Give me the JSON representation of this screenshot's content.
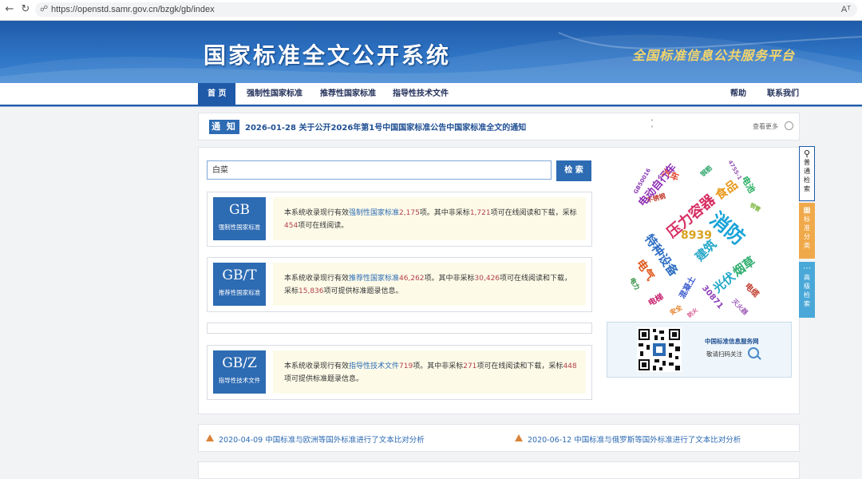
{
  "browser": {
    "back_icon": "arrow-left-icon",
    "reload_icon": "reload-icon",
    "url": "https://openstd.samr.gov.cn/bzgk/gb/index",
    "reader_label": "Aᵀ"
  },
  "banner": {
    "title": "国家标准全文公开系统",
    "slogan": "全国标准信息公共服务平台"
  },
  "nav": {
    "items": [
      "首 页",
      "强制性国家标准",
      "推荐性国家标准",
      "指导性技术文件"
    ],
    "right_items": [
      "帮助",
      "联系我们"
    ]
  },
  "notice": {
    "badge": "通 知",
    "text": "2026-01-28  关于公开2026年第1号中国国家标准公告中国家标准全文的通知",
    "more": "查看更多"
  },
  "search": {
    "value": "白菜",
    "button": "检 索"
  },
  "categories": [
    {
      "code": "GB",
      "subtitle": "强制性国家标准",
      "desc_parts": {
        "a": "本系统收录现行有效",
        "type": "强制性国家标准",
        "count": "2,175",
        "b": "项。其中非采标",
        "nonadopt": "1,721",
        "c": "项可在线阅读和下载，采标",
        "adopt": "454",
        "d": "项可在线阅读。"
      }
    },
    {
      "code": "GB/T",
      "subtitle": "推荐性国家标准",
      "desc_parts": {
        "a": "本系统收录现行有效",
        "type": "推荐性国家标准",
        "count": "46,262",
        "b": "项。其中非采标",
        "nonadopt": "30,426",
        "c": "项可在线阅读和下载，采标",
        "adopt": "15,836",
        "d": "项可提供标准题录信息。"
      }
    },
    {
      "code": "GB/Z",
      "subtitle": "指导性技术文件",
      "desc_parts": {
        "a": "本系统收录现行有效",
        "type": "指导性技术文件",
        "count": "719",
        "b": "项。其中非采标",
        "nonadopt": "271",
        "c": "项可在线阅读和下载，采标",
        "adopt": "448",
        "d": "项可提供标准题录信息。"
      }
    }
  ],
  "word_cloud": [
    {
      "text": "GB50016",
      "color": "#8b3fb5"
    },
    {
      "text": "汽车",
      "color": "#e0462f"
    },
    {
      "text": "钢筋",
      "color": "#2fa56b"
    },
    {
      "text": "4755-1",
      "color": "#9b59b6"
    },
    {
      "text": "不锈钢",
      "color": "#c0392b"
    },
    {
      "text": "电动自行车",
      "color": "#8e2fb5"
    },
    {
      "text": "食品",
      "color": "#e89a1d"
    },
    {
      "text": "电池",
      "color": "#27ae60"
    },
    {
      "text": "压力容器",
      "color": "#d62d62"
    },
    {
      "text": "钢管",
      "color": "#7ab63a"
    },
    {
      "text": "消防",
      "color": "#1aa3d8"
    },
    {
      "text": "8939",
      "color": "#d9a21f"
    },
    {
      "text": "特种设备",
      "color": "#2f6fc4"
    },
    {
      "text": "建筑",
      "color": "#27a8c9"
    },
    {
      "text": "电气",
      "color": "#e05a1e"
    },
    {
      "text": "烟草",
      "color": "#2fae6f"
    },
    {
      "text": "光伏",
      "color": "#1fa7c8"
    },
    {
      "text": "电力",
      "color": "#2b8c3a"
    },
    {
      "text": "混凝土",
      "color": "#3a5bd0"
    },
    {
      "text": "电梯",
      "color": "#c71c6a"
    },
    {
      "text": "30871",
      "color": "#8c3fb6"
    },
    {
      "text": "电缆",
      "color": "#c0392b"
    },
    {
      "text": "安全",
      "color": "#e67e22"
    },
    {
      "text": "防火",
      "color": "#d4508a"
    },
    {
      "text": "灭火器",
      "color": "#9b59b6"
    }
  ],
  "qr": {
    "title": "中国标准信息服务网",
    "subtitle": "敬请扫码关注"
  },
  "side_tabs": [
    "普通检索",
    "标准分类",
    "高级检索"
  ],
  "news": [
    "2020-04-09  中国标准与欧洲等国外标准进行了文本比对分析",
    "2020-06-12  中国标准与俄罗斯等国外标准进行了文本比对分析"
  ],
  "colors": {
    "primary": "#2d6bb3",
    "banner": "#1f5aa8",
    "slogan": "#f4d56a",
    "highlight_num": "#b4404a",
    "card_bg": "#fdfbe8"
  }
}
